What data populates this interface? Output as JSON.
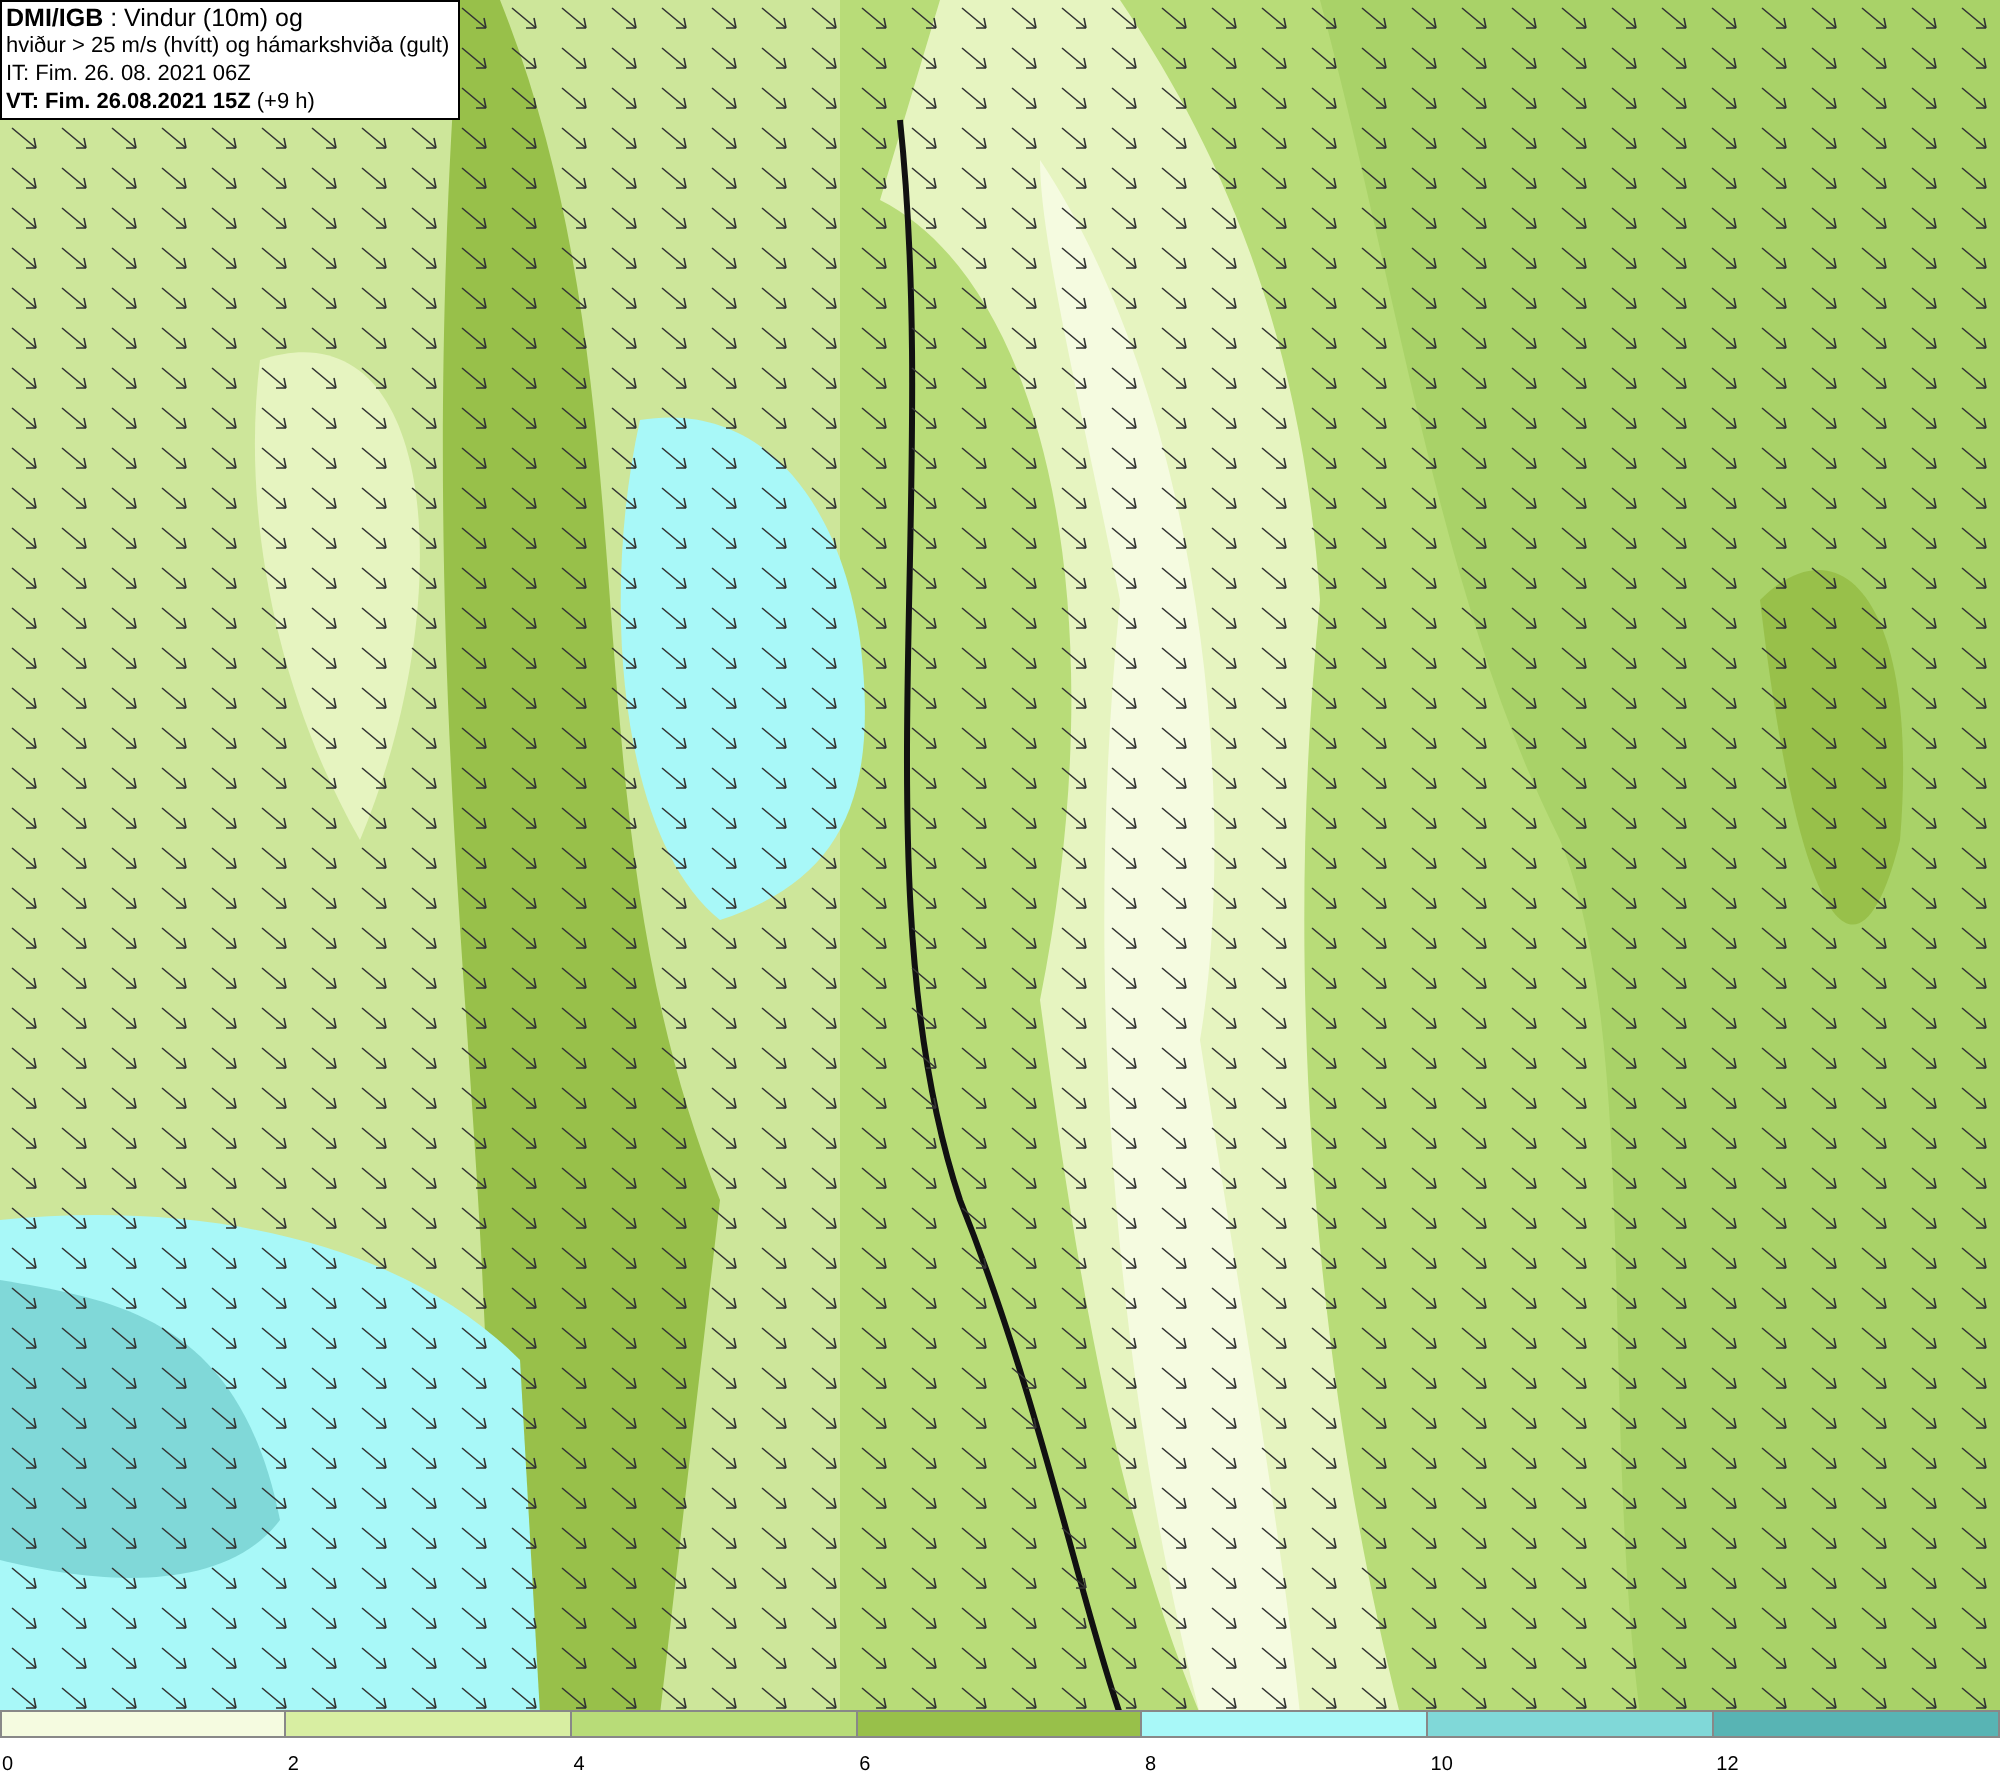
{
  "header": {
    "lines": [
      "**DMI/IGB** : Vindur (10m) og",
      "hviður > 25 m/s (hvítt) og hámarkshviða (gult)",
      "IT: Fim. 26. 08. 2021 06Z",
      "**VT: Fim. 26.08.2021 15Z** (+9 h)"
    ]
  },
  "legend": {
    "bins": [
      {
        "label": "0",
        "color": "#f5fbe0"
      },
      {
        "label": "2",
        "color": "#d8eea2"
      },
      {
        "label": "4",
        "color": "#b8dc78"
      },
      {
        "label": "6",
        "color": "#98c04a"
      },
      {
        "label": "8",
        "color": "#a8f8f8"
      },
      {
        "label": "10",
        "color": "#80d8d8"
      },
      {
        "label": "12",
        "color": "#58b4b4"
      }
    ]
  }
}
